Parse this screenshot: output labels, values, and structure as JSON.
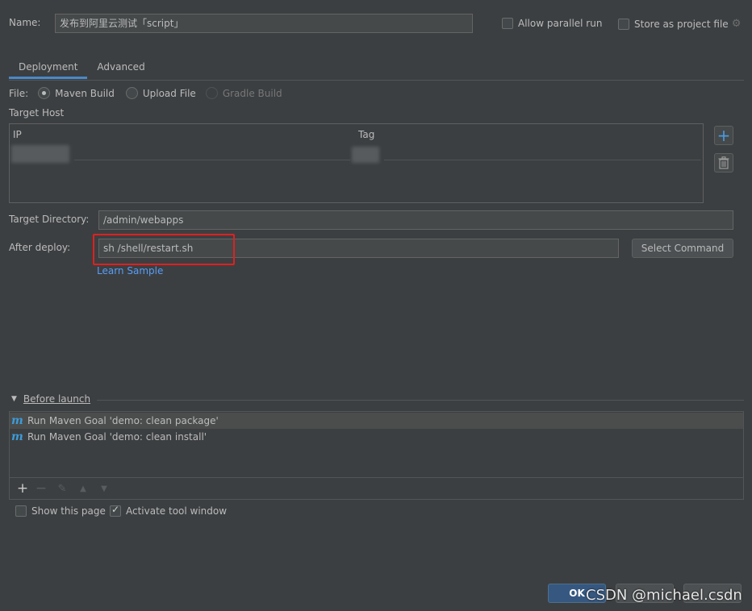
{
  "header": {
    "name_label": "Name:",
    "name_value": "发布到阿里云测试「script」",
    "allow_parallel_label": "Allow parallel run",
    "store_project_label": "Store as project file"
  },
  "tabs": [
    {
      "label": "Deployment",
      "active": true
    },
    {
      "label": "Advanced",
      "active": false
    }
  ],
  "file": {
    "label": "File:",
    "options": [
      {
        "label": "Maven Build",
        "selected": true,
        "enabled": true
      },
      {
        "label": "Upload File",
        "selected": false,
        "enabled": true
      },
      {
        "label": "Gradle Build",
        "selected": false,
        "enabled": false
      }
    ]
  },
  "target_host": {
    "label": "Target Host",
    "columns": [
      "IP",
      "Tag"
    ]
  },
  "target_directory": {
    "label": "Target Directory:",
    "value": "/admin/webapps"
  },
  "after_deploy": {
    "label": "After deploy:",
    "value": "sh /shell/restart.sh",
    "select_button": "Select Command",
    "learn_link": "Learn Sample"
  },
  "before_launch": {
    "label": "Before launch",
    "items": [
      "Run Maven Goal 'demo: clean package'",
      "Run Maven Goal 'demo: clean install'"
    ]
  },
  "options": {
    "show_page_label": "Show this page",
    "show_page_checked": false,
    "activate_label": "Activate tool window",
    "activate_checked": true
  },
  "footer": {
    "ok_label": "OK",
    "watermark": "CSDN @michael.csdn"
  },
  "colors": {
    "accent": "#4a88c7",
    "highlight_box": "#e02020",
    "link": "#589df6"
  }
}
